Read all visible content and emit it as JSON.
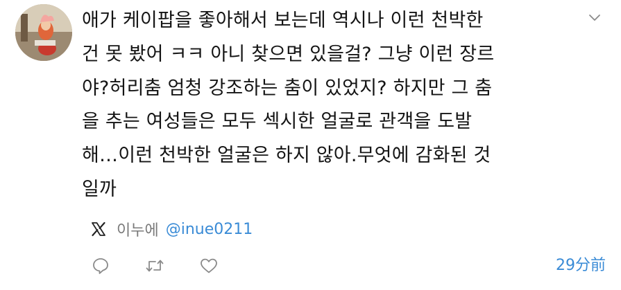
{
  "post": {
    "avatar_icon": "profile-photo-icon",
    "text": "애가 케이팝을 좋아해서 보는데 역시나 이런 천박한\n건 못 봤어 ㅋㅋ 아니 찾으면 있을걸? 그냥 이런 장르\n야?허리춤 엄청 강조하는 춤이 있었지? 하지만 그 춤\n을 추는 여성들은 모두 섹시한 얼굴로 관객을 도발\n해…이런 천박한 얼굴은 하지 않아.무엇에 감화된 것\n일까",
    "source": {
      "platform_icon": "x-logo-icon",
      "name": "이누에",
      "handle": "@inue0211"
    },
    "actions": {
      "reply_icon": "reply-icon",
      "repost_icon": "repost-icon",
      "like_icon": "heart-icon"
    },
    "more_icon": "chevron-down-icon",
    "timestamp": "29分前"
  },
  "colors": {
    "text": "#141414",
    "muted": "#7a7a7a",
    "link": "#3a8bd6",
    "icon": "#8a8a8a"
  }
}
